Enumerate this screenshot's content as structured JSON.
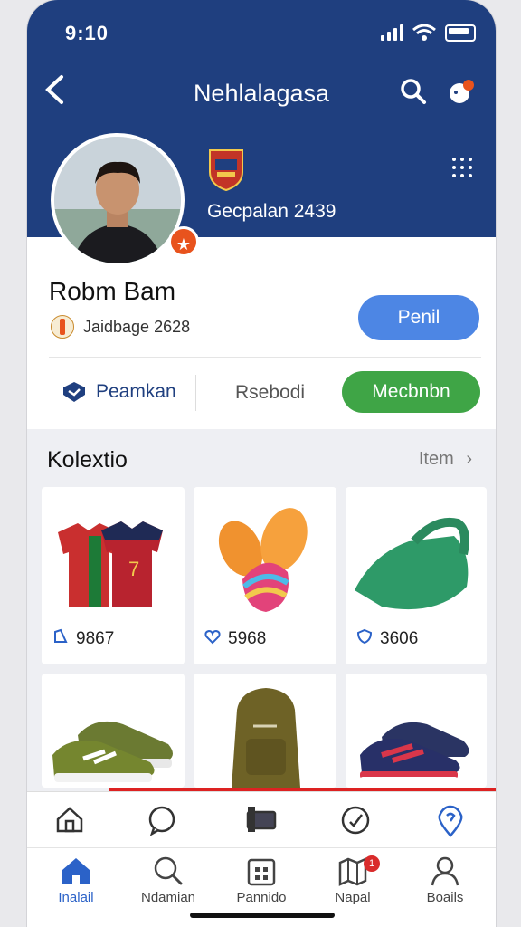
{
  "status_bar": {
    "time": "9:10"
  },
  "nav": {
    "title": "Nehlalagasa"
  },
  "profile": {
    "club_text": "Gecpalan 2439",
    "name": "Robm Bam",
    "info": "Jaidbage 2628",
    "action_button": "Penil"
  },
  "tabs": {
    "tab1": "Peamkan",
    "tab2": "Rsebodi",
    "tab3": "Mecbnbn"
  },
  "collection": {
    "title": "Kolextio",
    "more": "Item",
    "items": [
      {
        "name": "jerseys",
        "count": "9867"
      },
      {
        "name": "insoles",
        "count": "5968"
      },
      {
        "name": "visor",
        "count": "3606"
      },
      {
        "name": "sneakers-olive",
        "count": ""
      },
      {
        "name": "backpack",
        "count": ""
      },
      {
        "name": "sneakers-navy",
        "count": ""
      }
    ]
  },
  "tab_bar": [
    {
      "label": "Inalail",
      "icon": "home-icon",
      "active": true
    },
    {
      "label": "Ndamian",
      "icon": "search-icon",
      "active": false
    },
    {
      "label": "Pannido",
      "icon": "calendar-icon",
      "active": false
    },
    {
      "label": "Napal",
      "icon": "map-icon",
      "active": false,
      "badge": "1"
    },
    {
      "label": "Boails",
      "icon": "profile-icon",
      "active": false
    }
  ],
  "colors": {
    "header": "#1f3f7f",
    "primary_blue": "#4d86e4",
    "green": "#3fa546",
    "accent_orange": "#e8531d"
  }
}
